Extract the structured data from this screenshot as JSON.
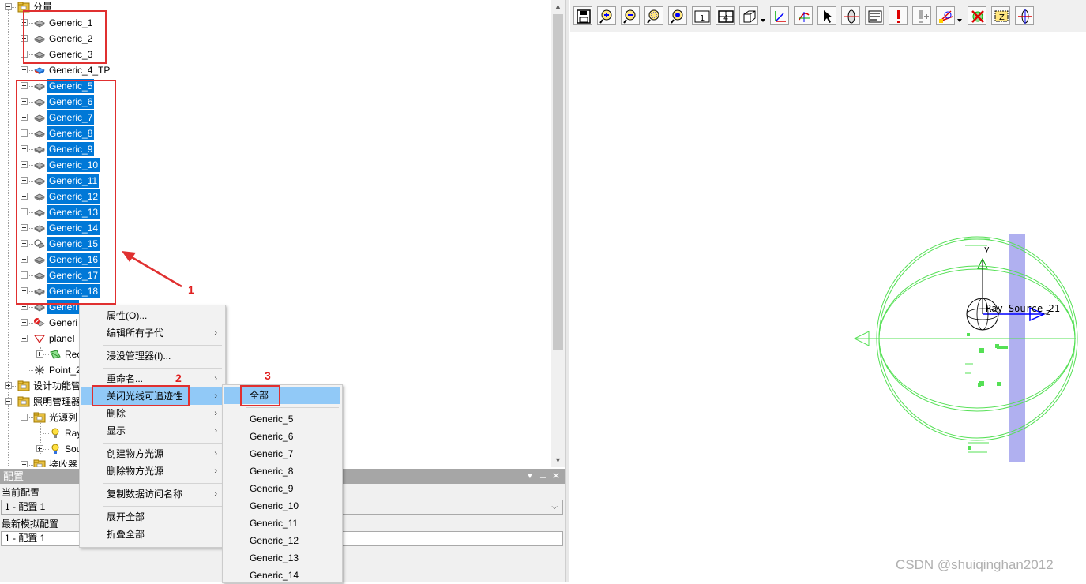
{
  "tree": {
    "nodes": [
      {
        "id": "component",
        "label": "分量",
        "level": 0,
        "icon": "folder-icon",
        "expander": "minus",
        "selected": false
      },
      {
        "id": "generic-1",
        "label": "Generic_1",
        "level": 1,
        "icon": "generic-part-icon",
        "expander": "plus",
        "selected": false
      },
      {
        "id": "generic-2",
        "label": "Generic_2",
        "level": 1,
        "icon": "generic-part-icon",
        "expander": "plus",
        "selected": false
      },
      {
        "id": "generic-3",
        "label": "Generic_3",
        "level": 1,
        "icon": "generic-part-icon",
        "expander": "plus",
        "selected": false
      },
      {
        "id": "generic-4-tp",
        "label": "Generic_4_TP",
        "level": 1,
        "icon": "colored-part-icon",
        "expander": "plus",
        "selected": false
      },
      {
        "id": "generic-5",
        "label": "Generic_5",
        "level": 1,
        "icon": "generic-part-icon",
        "expander": "plus",
        "selected": true
      },
      {
        "id": "generic-6",
        "label": "Generic_6",
        "level": 1,
        "icon": "generic-part-icon",
        "expander": "plus",
        "selected": true
      },
      {
        "id": "generic-7",
        "label": "Generic_7",
        "level": 1,
        "icon": "generic-part-icon",
        "expander": "plus",
        "selected": true
      },
      {
        "id": "generic-8",
        "label": "Generic_8",
        "level": 1,
        "icon": "generic-part-icon",
        "expander": "plus",
        "selected": true
      },
      {
        "id": "generic-9",
        "label": "Generic_9",
        "level": 1,
        "icon": "generic-part-icon",
        "expander": "plus",
        "selected": true
      },
      {
        "id": "generic-10",
        "label": "Generic_10",
        "level": 1,
        "icon": "generic-part-icon",
        "expander": "plus",
        "selected": true
      },
      {
        "id": "generic-11",
        "label": "Generic_11",
        "level": 1,
        "icon": "generic-part-icon",
        "expander": "plus",
        "selected": true
      },
      {
        "id": "generic-12",
        "label": "Generic_12",
        "level": 1,
        "icon": "generic-part-icon",
        "expander": "plus",
        "selected": true
      },
      {
        "id": "generic-13",
        "label": "Generic_13",
        "level": 1,
        "icon": "generic-part-icon",
        "expander": "plus",
        "selected": true
      },
      {
        "id": "generic-14",
        "label": "Generic_14",
        "level": 1,
        "icon": "generic-part-icon",
        "expander": "plus",
        "selected": true
      },
      {
        "id": "generic-15",
        "label": "Generic_15",
        "level": 1,
        "icon": "lens-part-icon",
        "expander": "plus",
        "selected": true
      },
      {
        "id": "generic-16",
        "label": "Generic_16",
        "level": 1,
        "icon": "generic-part-icon",
        "expander": "plus",
        "selected": true
      },
      {
        "id": "generic-17",
        "label": "Generic_17",
        "level": 1,
        "icon": "generic-part-icon",
        "expander": "plus",
        "selected": true
      },
      {
        "id": "generic-18",
        "label": "Generic_18",
        "level": 1,
        "icon": "generic-part-icon",
        "expander": "plus",
        "selected": true
      },
      {
        "id": "generic-19",
        "label": "Generi",
        "level": 1,
        "icon": "generic-part-icon",
        "expander": "plus",
        "selected": true
      },
      {
        "id": "generic-20",
        "label": "Generi",
        "level": 1,
        "icon": "error-part-icon",
        "expander": "plus",
        "selected": false
      },
      {
        "id": "plane",
        "label": "planeI",
        "level": 1,
        "icon": "plane-icon",
        "expander": "minus",
        "selected": false
      },
      {
        "id": "rec",
        "label": "Rec",
        "level": 2,
        "icon": "receiver-icon",
        "expander": "plus",
        "selected": false
      },
      {
        "id": "point",
        "label": "Point_2",
        "level": 1,
        "icon": "point-icon",
        "expander": "none",
        "selected": false
      },
      {
        "id": "design",
        "label": "设计功能管",
        "level": 0,
        "icon": "folder-icon",
        "expander": "plus",
        "selected": false
      },
      {
        "id": "lighting",
        "label": "照明管理器",
        "level": 0,
        "icon": "folder-icon",
        "expander": "minus",
        "selected": false
      },
      {
        "id": "sources",
        "label": "光源列",
        "level": 1,
        "icon": "folder-icon",
        "expander": "minus",
        "selected": false
      },
      {
        "id": "ray-src",
        "label": "Ray",
        "level": 2,
        "icon": "bulb-icon",
        "expander": "none",
        "selected": false
      },
      {
        "id": "sou-src",
        "label": "Sou",
        "level": 2,
        "icon": "colored-bulb-icon",
        "expander": "plus",
        "selected": false
      },
      {
        "id": "receivers",
        "label": "接收器",
        "level": 1,
        "icon": "folder-icon",
        "expander": "plus",
        "selected": false
      }
    ]
  },
  "config": {
    "title": "配置",
    "current_label": "当前配置",
    "current_value": "1 - 配置 1",
    "latest_label": "最新模拟配置",
    "latest_value": "1 - 配置 1"
  },
  "context_menu": {
    "items": [
      {
        "label": "属性(O)...",
        "submenu": false
      },
      {
        "label": "编辑所有子代",
        "submenu": true
      },
      {
        "sep": true
      },
      {
        "label": "浸没管理器(I)...",
        "submenu": false
      },
      {
        "sep": true
      },
      {
        "label": "重命名...",
        "submenu": true
      },
      {
        "label": "关闭光线可追迹性",
        "submenu": true,
        "highlight": true
      },
      {
        "label": "删除",
        "submenu": true
      },
      {
        "label": "显示",
        "submenu": true
      },
      {
        "sep": true
      },
      {
        "label": "创建物方光源",
        "submenu": true
      },
      {
        "label": "删除物方光源",
        "submenu": true
      },
      {
        "sep": true
      },
      {
        "label": "复制数据访问名称",
        "submenu": true
      },
      {
        "sep": true
      },
      {
        "label": "展开全部",
        "submenu": false
      },
      {
        "label": "折叠全部",
        "submenu": false
      }
    ]
  },
  "submenu": {
    "items": [
      {
        "label": "全部",
        "highlight": true
      },
      {
        "sep": true
      },
      {
        "label": "Generic_5"
      },
      {
        "label": "Generic_6"
      },
      {
        "label": "Generic_7"
      },
      {
        "label": "Generic_8"
      },
      {
        "label": "Generic_9"
      },
      {
        "label": "Generic_10"
      },
      {
        "label": "Generic_11"
      },
      {
        "label": "Generic_12"
      },
      {
        "label": "Generic_13"
      },
      {
        "label": "Generic_14"
      }
    ]
  },
  "viewport": {
    "toolbar_icons": [
      "save-icon",
      "zoom-in-icon",
      "zoom-out-icon",
      "zoom-window-icon",
      "zoom-fit-icon",
      "one-view-icon",
      "four-view-icon",
      "cube-view-icon",
      "axis-icon",
      "rotate-icon",
      "select-arrow-icon",
      "lens-icon",
      "grid-icon",
      "alert-icon",
      "alert-add-icon",
      "ray-trace-icon",
      "ray-off-icon",
      "z-box-icon",
      "clip-icon"
    ],
    "axis_y": "y",
    "axis_z": "z",
    "scene_label": "Ray   Source_21",
    "colors": {
      "wire": "#55e055",
      "plate": "#b0b0f0",
      "axis_blue": "#0000ff"
    }
  },
  "annotations": {
    "n1": "1",
    "n2": "2",
    "n3": "3"
  },
  "watermark": "CSDN @shuiqinghan2012",
  "colors": {
    "selection": "#0078d7",
    "annotation": "#e03030",
    "menu_highlight": "#91c9f7"
  }
}
